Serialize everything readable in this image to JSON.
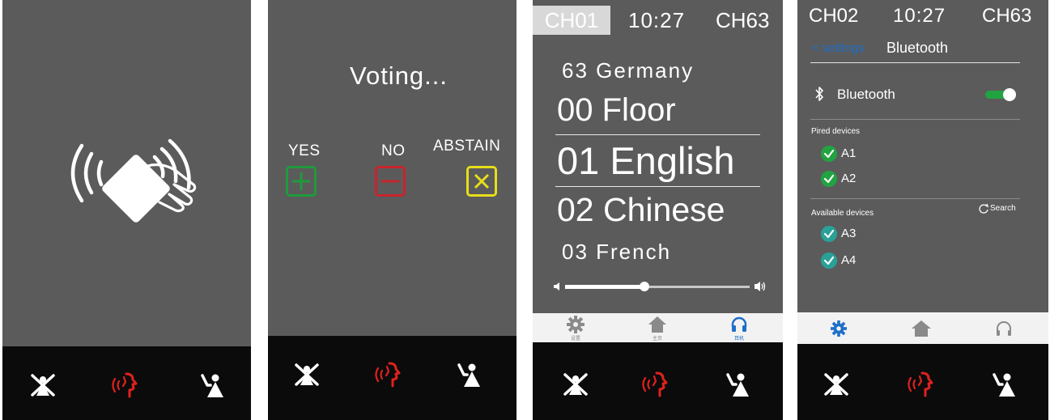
{
  "panel2": {
    "title": "Voting...",
    "options": {
      "yes": "YES",
      "no": "NO",
      "abstain": "ABSTAIN"
    },
    "colors": {
      "yes": "#1f9a3c",
      "no": "#c8242c",
      "abstain": "#e7de1a"
    }
  },
  "panel3": {
    "header": {
      "left": "CH01",
      "time": "10:27",
      "right": "CH63"
    },
    "channels": [
      "63 Germany",
      "00 Floor",
      "01 English",
      "02 Chinese",
      "03 French"
    ],
    "volume_level": 0.43,
    "nav": {
      "settings_caption": "设置",
      "home_caption": "主页",
      "headphone_caption": "耳机"
    }
  },
  "panel4": {
    "header": {
      "left": "CH02",
      "time": "10:27",
      "right": "CH63"
    },
    "back": "< settings",
    "title": "Bluetooth",
    "bluetooth_label": "Bluetooth",
    "bluetooth_on": true,
    "paired_header": "Pired devices",
    "paired": [
      "A1",
      "A2"
    ],
    "available_header": "Available devices",
    "search_label": "Search",
    "available": [
      "A3",
      "A4"
    ]
  },
  "icons": {
    "tap_card": "nfc-tap-icon",
    "mic_off": "mic-off-person-icon",
    "speak": "speaking-icon",
    "raise_hand": "raise-hand-icon",
    "settings": "gear-icon",
    "home": "home-icon",
    "headphone": "headphone-icon",
    "bluetooth": "bluetooth-icon"
  },
  "accent_colors": {
    "speak_red": "#e0211d",
    "bluetooth_blue": "#1e6fc9",
    "check_teal": "#2aa198",
    "check_green": "#22a341"
  }
}
